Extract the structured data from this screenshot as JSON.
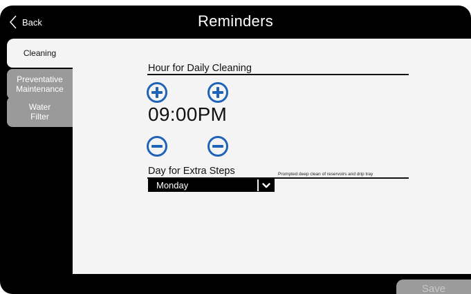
{
  "header": {
    "back_label": "Back",
    "title": "Reminders"
  },
  "tabs": [
    {
      "label": "Cleaning",
      "active": true
    },
    {
      "label": "Preventative\nMaintenance",
      "active": false
    },
    {
      "label": "Water\nFilter",
      "active": false
    }
  ],
  "daily_cleaning": {
    "label": "Hour for Daily Cleaning",
    "time": "09:00PM"
  },
  "extra_steps": {
    "label": "Day for Extra Steps",
    "hint": "Prompted deep clean of reservoirs and drip tray",
    "selected_day": "Monday"
  },
  "footer": {
    "save_label": "Save"
  },
  "colors": {
    "accent_blue": "#1f63b8",
    "panel_bg": "#f4f4f4",
    "tab_inactive": "#9a9a9a",
    "frame": "#000000"
  }
}
